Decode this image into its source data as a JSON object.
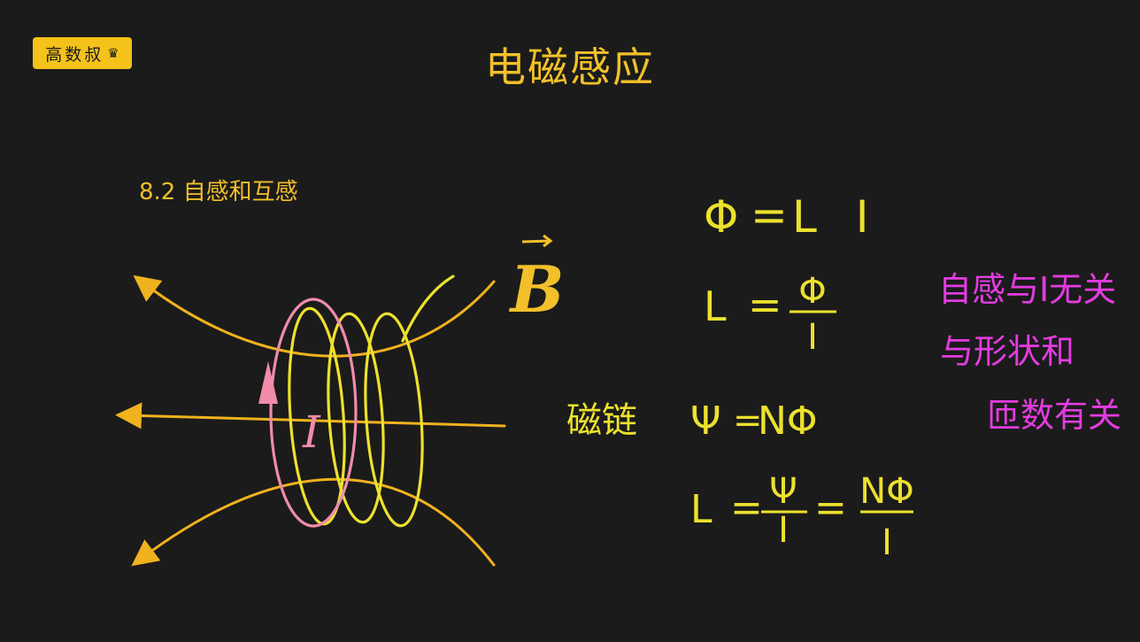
{
  "logo": {
    "text": "高数叔",
    "icon": "crown-icon"
  },
  "title": "电磁感应",
  "section_heading": "8.2 自感和互感",
  "diagram": {
    "field_label": "B",
    "current_label": "I"
  },
  "formulas": {
    "f1": {
      "lhs": "Φ",
      "eq": "=",
      "rhs": "L I"
    },
    "f2": {
      "lhs": "L",
      "eq": "=",
      "num": "Φ",
      "den": "I"
    },
    "f3": {
      "label": "磁链",
      "lhs": "Ψ",
      "eq": "=",
      "rhs": "NΦ"
    },
    "f4": {
      "lhs": "L",
      "eq1": "=",
      "num1": "Ψ",
      "den1": "I",
      "eq2": "=",
      "num2": "NΦ",
      "den2": "I"
    }
  },
  "note": {
    "line1": "自感与I无关",
    "line2": "与形状和",
    "line3": "匝数有关"
  },
  "colors": {
    "background": "#1b1b1b",
    "accent": "#f2c02a",
    "field": "#f0b21e",
    "coil": "#ece12d",
    "current": "#f08caa",
    "note": "#e33ce0"
  }
}
